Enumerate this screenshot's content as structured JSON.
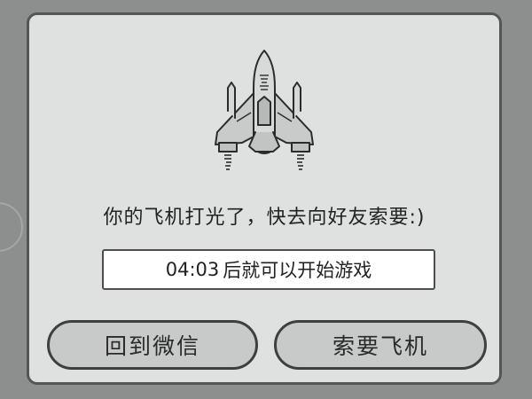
{
  "dialog": {
    "message": "你的飞机打光了，快去向好友索要:)",
    "countdown_time": "04:03",
    "countdown_suffix": "后就可以开始游戏",
    "buttons": {
      "back_to_wechat": "回到微信",
      "request_plane": "索要飞机"
    },
    "icon": "paper-airplane-jet-icon"
  },
  "colors": {
    "background": "#8d8f8e",
    "dialog_bg": "#dfe1e0",
    "button_bg": "#c8cac9",
    "border": "#3e3f3e"
  }
}
